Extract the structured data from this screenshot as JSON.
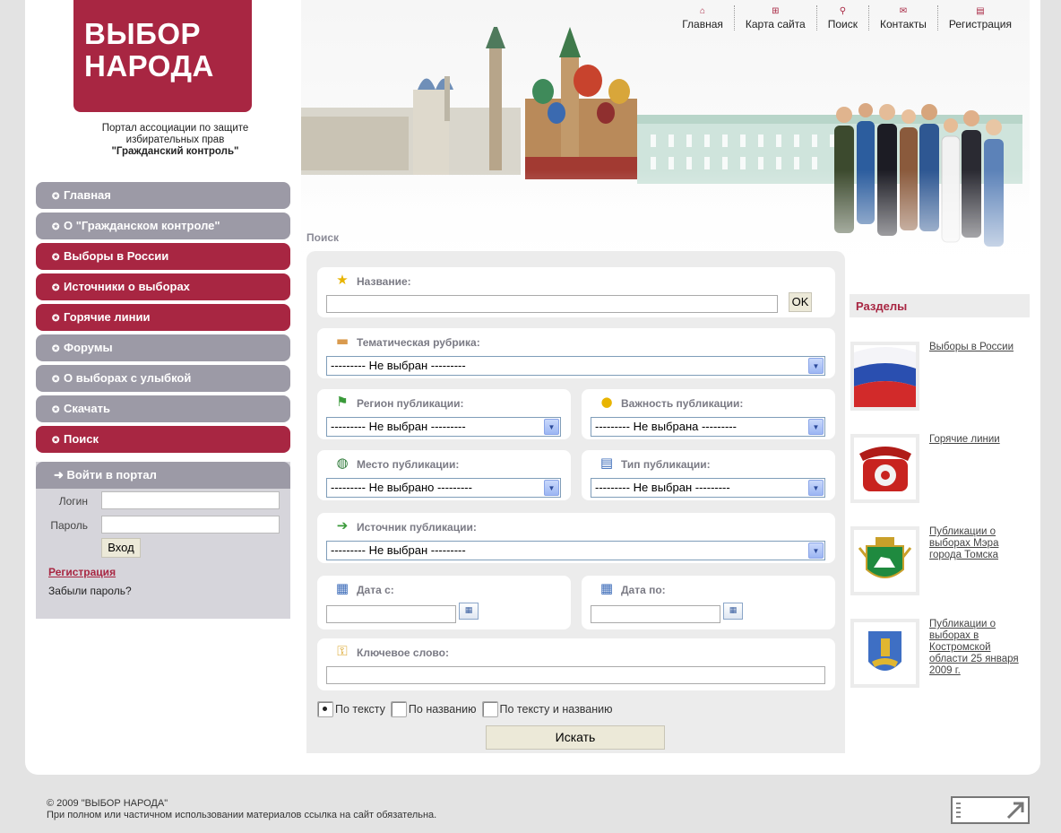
{
  "logo": {
    "line1": "ВЫБОР",
    "line2": "НАРОДА"
  },
  "tagline": {
    "line1": "Портал ассоциации по защите",
    "line2": "избирательных прав",
    "line3": "\"Гражданский контроль\""
  },
  "topnav": [
    {
      "label": "Главная",
      "icon": "home-icon"
    },
    {
      "label": "Карта сайта",
      "icon": "sitemap-icon"
    },
    {
      "label": "Поиск",
      "icon": "search-icon"
    },
    {
      "label": "Контакты",
      "icon": "mail-icon"
    },
    {
      "label": "Регистрация",
      "icon": "register-icon"
    }
  ],
  "menu": [
    {
      "label": "Главная",
      "style": "grey"
    },
    {
      "label": "О \"Гражданском контроле\"",
      "style": "grey"
    },
    {
      "label": "Выборы в России",
      "style": "red"
    },
    {
      "label": "Источники о выборах",
      "style": "red"
    },
    {
      "label": "Горячие линии",
      "style": "red"
    },
    {
      "label": "Форумы",
      "style": "grey"
    },
    {
      "label": "О выборах с улыбкой",
      "style": "grey"
    },
    {
      "label": "Скачать",
      "style": "grey"
    },
    {
      "label": "Поиск",
      "style": "red"
    }
  ],
  "login": {
    "title": "Войти в портал",
    "login_label": "Логин",
    "password_label": "Пароль",
    "submit": "Вход",
    "register": "Регистрация",
    "forgot": "Забыли пароль?"
  },
  "breadcrumb": "Поиск",
  "search": {
    "name_label": "Название:",
    "ok": "OK",
    "rubric_label": "Тематическая рубрика:",
    "rubric_value": "--------- Не выбран ---------",
    "region_label": "Регион публикации:",
    "region_value": "--------- Не выбран ---------",
    "importance_label": "Важность публикации:",
    "importance_value": "--------- Не выбрана ---------",
    "place_label": "Место публикации:",
    "place_value": "--------- Не выбрано ---------",
    "type_label": "Тип публикации:",
    "type_value": "--------- Не выбран ---------",
    "source_label": "Источник публикации:",
    "source_value": "--------- Не выбран ---------",
    "date_from_label": "Дата с:",
    "date_to_label": "Дата по:",
    "keyword_label": "Ключевое слово:",
    "radio_text": "По тексту",
    "radio_title": "По названию",
    "radio_both": "По тексту и названию",
    "submit": "Искать"
  },
  "sections": {
    "title": "Разделы",
    "items": [
      {
        "label": "Выборы в России",
        "thumb": "russian-flag"
      },
      {
        "label": "Горячие линии",
        "thumb": "red-telephone"
      },
      {
        "label": "Публикации о выборах Мэра города Томска",
        "thumb": "tomsk-coat-of-arms"
      },
      {
        "label": "Публикации о выборах в Костромской области 25 января 2009 г.",
        "thumb": "kostroma-coat-of-arms"
      }
    ]
  },
  "footer": {
    "copyright": "© 2009 \"ВЫБОР НАРОДА\"",
    "notice": "При полном или частичном использовании материалов ссылка на сайт обязательна."
  },
  "colors": {
    "brand": "#a82642",
    "menu_grey": "#9c9aa6",
    "panel": "#ececec"
  }
}
